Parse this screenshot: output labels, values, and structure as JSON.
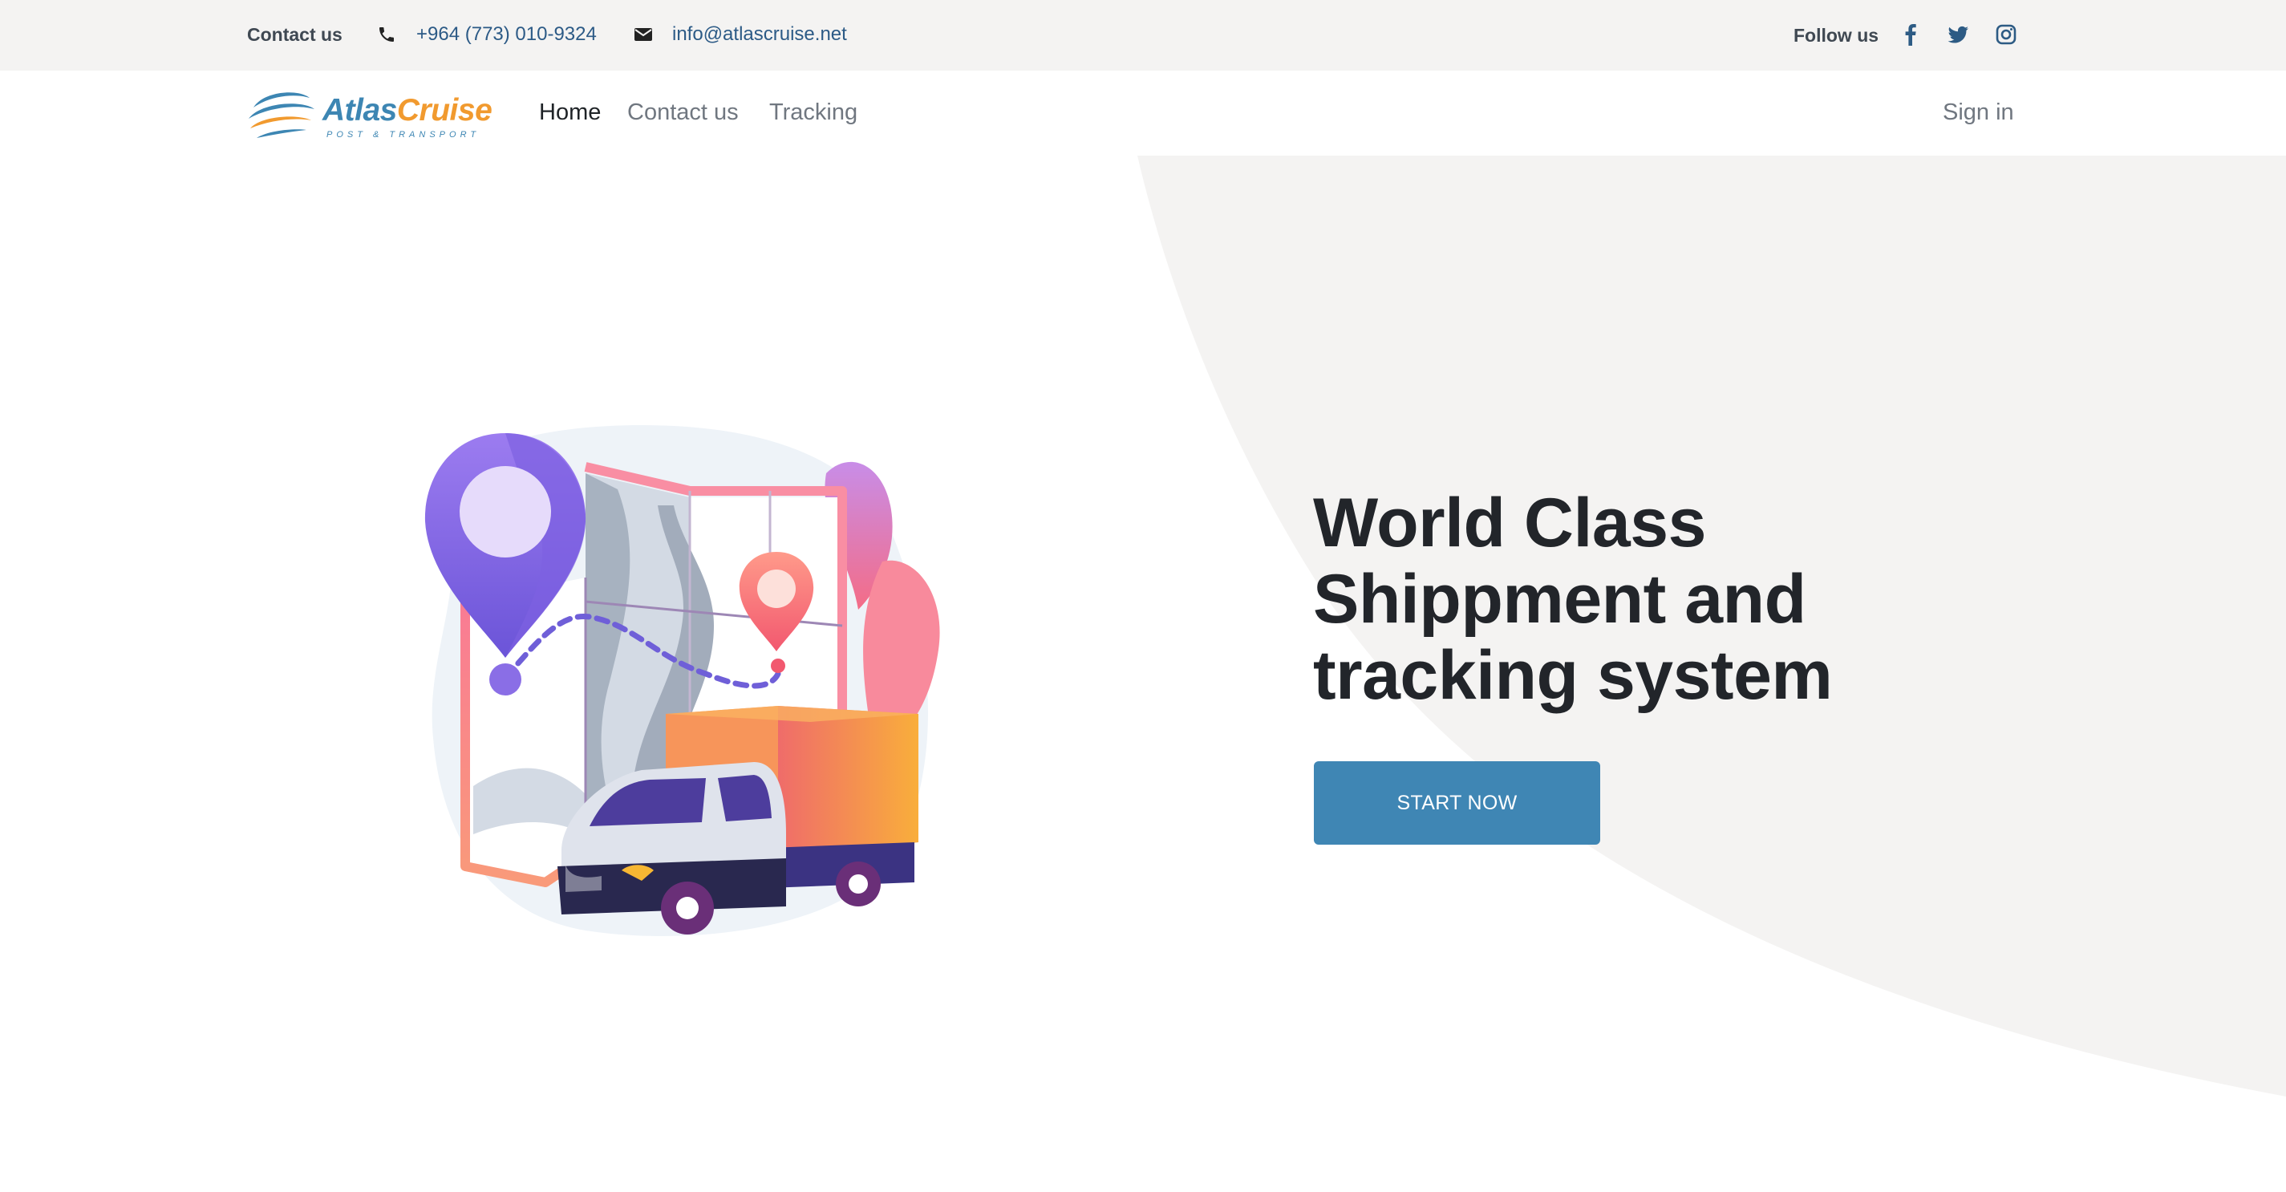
{
  "topbar": {
    "contact_label": "Contact us",
    "phone": "+964 (773) 010-9324",
    "email": "info@atlascruise.net",
    "follow_label": "Follow us",
    "social_icons": [
      "facebook-icon",
      "twitter-icon",
      "instagram-icon"
    ]
  },
  "brand": {
    "name_part1": "Atlas",
    "name_part2": "Cruise",
    "tagline": "POST & TRANSPORT",
    "colors": {
      "blue": "#3d86b3",
      "orange": "#f19a2f"
    }
  },
  "nav": {
    "home": "Home",
    "contact": "Contact us",
    "tracking": "Tracking",
    "signin": "Sign in"
  },
  "hero": {
    "headline_line1": "World Class",
    "headline_line2": "Shippment and",
    "headline_line3": "tracking system",
    "cta_label": "START NOW",
    "cta_color": "#3f86b4",
    "background_shape_color": "#f4f3f2"
  }
}
